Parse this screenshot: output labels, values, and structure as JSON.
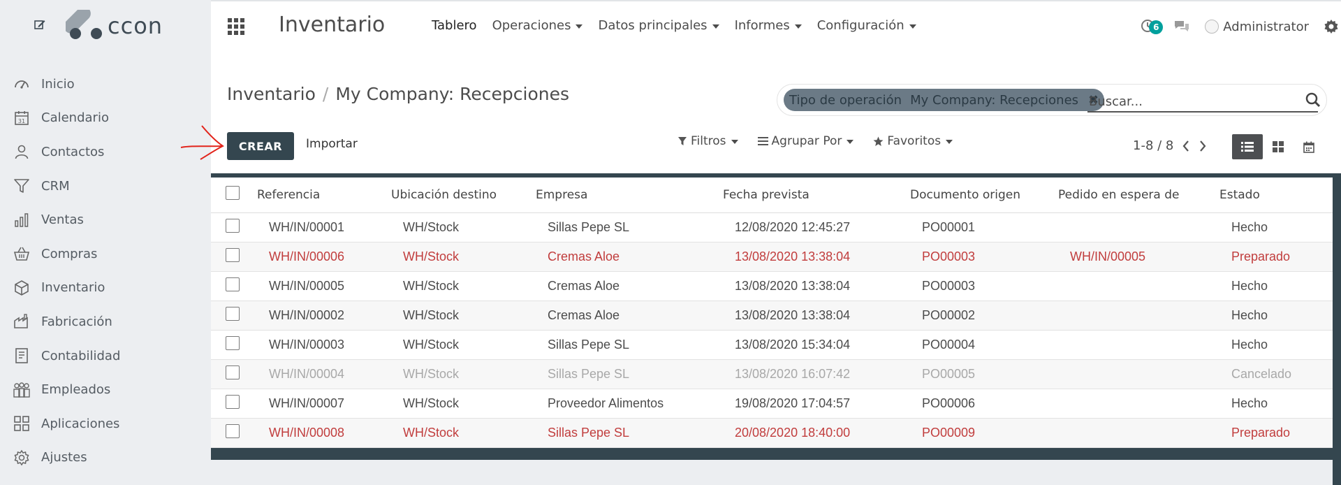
{
  "sidebar": {
    "logo_text": "ccon",
    "items": [
      {
        "label": "Inicio",
        "icon": "dashboard-icon"
      },
      {
        "label": "Calendario",
        "icon": "calendar-icon"
      },
      {
        "label": "Contactos",
        "icon": "user-icon"
      },
      {
        "label": "CRM",
        "icon": "filter-funnel-icon"
      },
      {
        "label": "Ventas",
        "icon": "bar-chart-icon"
      },
      {
        "label": "Compras",
        "icon": "basket-icon"
      },
      {
        "label": "Inventario",
        "icon": "box-icon"
      },
      {
        "label": "Fabricación",
        "icon": "factory-icon"
      },
      {
        "label": "Contabilidad",
        "icon": "ledger-icon"
      },
      {
        "label": "Empleados",
        "icon": "people-icon"
      },
      {
        "label": "Aplicaciones",
        "icon": "apps-grid-icon"
      },
      {
        "label": "Ajustes",
        "icon": "gear-icon"
      }
    ]
  },
  "topbar": {
    "app_title": "Inventario",
    "menu": [
      {
        "label": "Tablero",
        "dropdown": false
      },
      {
        "label": "Operaciones",
        "dropdown": true
      },
      {
        "label": "Datos principales",
        "dropdown": true
      },
      {
        "label": "Informes",
        "dropdown": true
      },
      {
        "label": "Configuración",
        "dropdown": true
      }
    ],
    "activity_count": "6",
    "user_name": "Administrator"
  },
  "control_panel": {
    "breadcrumb_root": "Inventario",
    "breadcrumb_sep": "/",
    "breadcrumb_current": "My Company: Recepciones",
    "facet_label": "Tipo de operación",
    "facet_value": "My Company: Recepciones",
    "facet_remove": "✖",
    "search_placeholder": "Buscar...",
    "create_label": "CREAR",
    "import_label": "Importar",
    "filters_label": "Filtros",
    "groupby_label": "Agrupar Por",
    "favorites_label": "Favoritos",
    "pager": "1-8 / 8"
  },
  "colors": {
    "primary_dark": "#34464f",
    "late_red": "#c13d3d",
    "cancelled_gray": "#a8a8a8",
    "badge_teal": "#00a09d"
  },
  "table": {
    "headers": [
      "Referencia",
      "Ubicación destino",
      "Empresa",
      "Fecha prevista",
      "Documento origen",
      "Pedido en espera de",
      "Estado"
    ],
    "rows": [
      {
        "style": "normal",
        "cells": [
          "WH/IN/00001",
          "WH/Stock",
          "Sillas Pepe SL",
          "12/08/2020 12:45:27",
          "PO00001",
          "",
          "Hecho"
        ]
      },
      {
        "style": "red",
        "cells": [
          "WH/IN/00006",
          "WH/Stock",
          "Cremas Aloe",
          "13/08/2020 13:38:04",
          "PO00003",
          "WH/IN/00005",
          "Preparado"
        ]
      },
      {
        "style": "normal",
        "cells": [
          "WH/IN/00005",
          "WH/Stock",
          "Cremas Aloe",
          "13/08/2020 13:38:04",
          "PO00003",
          "",
          "Hecho"
        ]
      },
      {
        "style": "normal",
        "cells": [
          "WH/IN/00002",
          "WH/Stock",
          "Cremas Aloe",
          "13/08/2020 13:38:04",
          "PO00002",
          "",
          "Hecho"
        ]
      },
      {
        "style": "normal",
        "cells": [
          "WH/IN/00003",
          "WH/Stock",
          "Sillas Pepe SL",
          "13/08/2020 15:34:04",
          "PO00004",
          "",
          "Hecho"
        ]
      },
      {
        "style": "muted",
        "cells": [
          "WH/IN/00004",
          "WH/Stock",
          "Sillas Pepe SL",
          "13/08/2020 16:07:42",
          "PO00005",
          "",
          "Cancelado"
        ]
      },
      {
        "style": "normal",
        "cells": [
          "WH/IN/00007",
          "WH/Stock",
          "Proveedor Alimentos",
          "19/08/2020 17:04:57",
          "PO00006",
          "",
          "Hecho"
        ]
      },
      {
        "style": "red",
        "cells": [
          "WH/IN/00008",
          "WH/Stock",
          "Sillas Pepe SL",
          "20/08/2020 18:40:00",
          "PO00009",
          "",
          "Preparado"
        ]
      }
    ]
  }
}
